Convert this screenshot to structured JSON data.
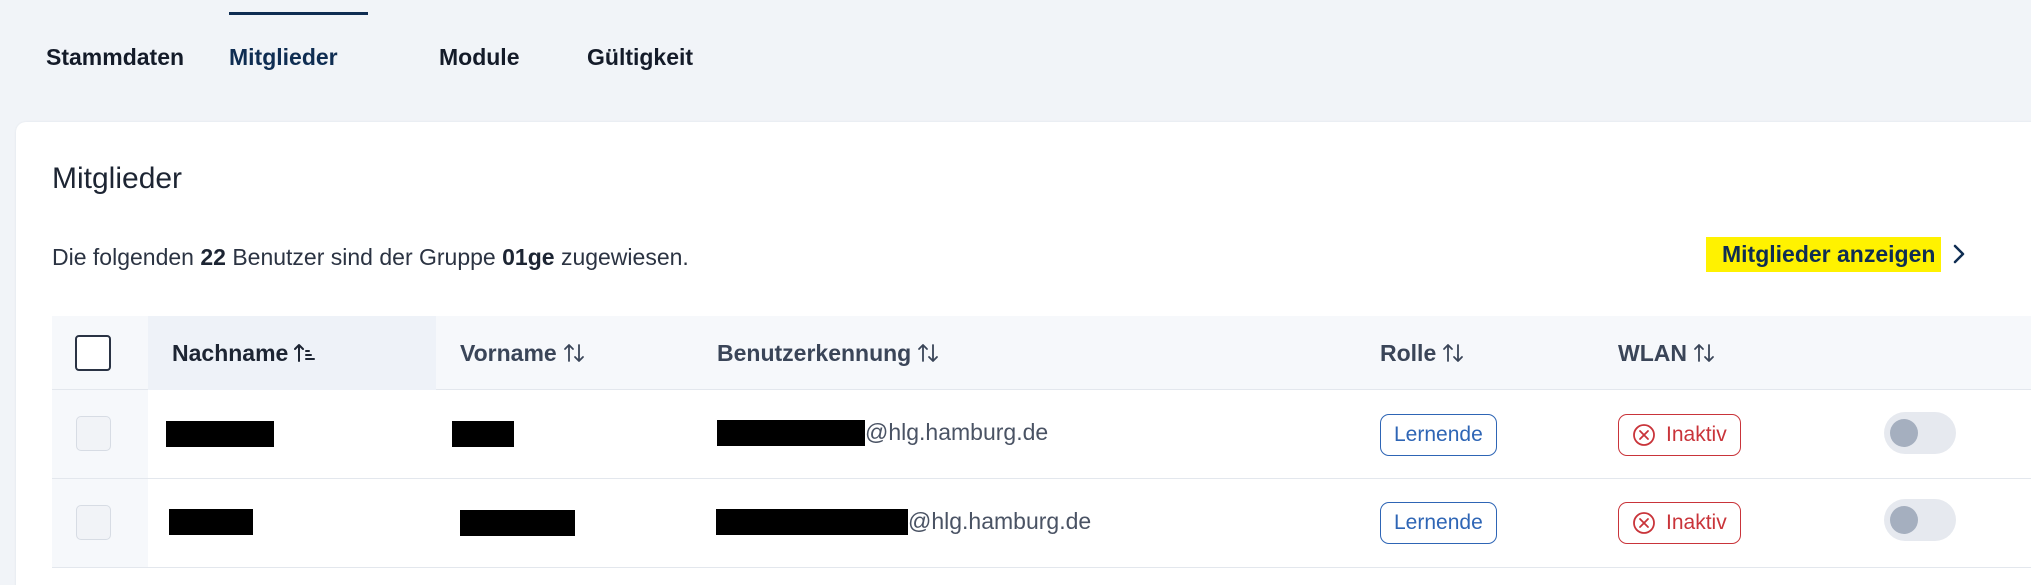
{
  "tabs": [
    {
      "label": "Stammdaten",
      "active": false
    },
    {
      "label": "Mitglieder",
      "active": true
    },
    {
      "label": "Module",
      "active": false
    },
    {
      "label": "Gültigkeit",
      "active": false
    }
  ],
  "card": {
    "title": "Mitglieder",
    "summary": {
      "prefix": "Die folgenden",
      "count": "22",
      "middle": "Benutzer sind der Gruppe",
      "group": "01ge",
      "suffix": "zugewiesen."
    },
    "show_members_label": "Mitglieder anzeigen"
  },
  "table": {
    "columns": [
      "Nachname",
      "Vorname",
      "Benutzerkennung",
      "Rolle",
      "WLAN"
    ],
    "sorted_column": "Nachname",
    "rows": [
      {
        "nachname": "[redacted]",
        "vorname": "[redacted]",
        "email_domain": "@hlg.hamburg.de",
        "rolle": "Lernende",
        "wlan": "Inaktiv",
        "toggle_on": false
      },
      {
        "nachname": "[redacted]",
        "vorname": "[redacted]",
        "email_domain": "@hlg.hamburg.de",
        "rolle": "Lernende",
        "wlan": "Inaktiv",
        "toggle_on": false
      }
    ]
  },
  "colors": {
    "active_tab": "#0f2d52",
    "highlight": "#fff200",
    "role_badge": "#2e65b5",
    "inactive_badge": "#c9343a"
  }
}
